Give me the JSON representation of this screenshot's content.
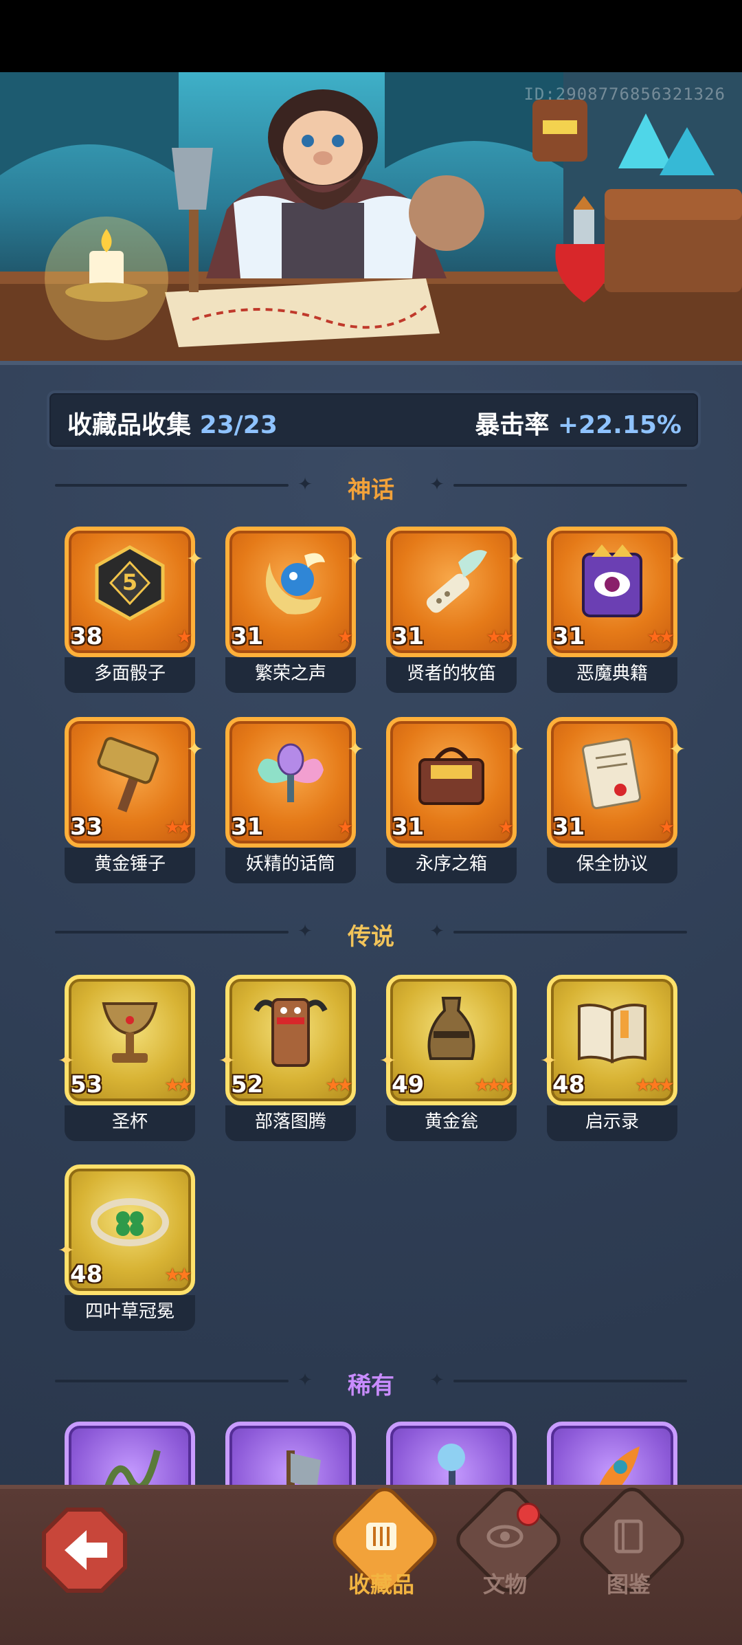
{
  "header": {
    "player_id": "ID:2908776856321326"
  },
  "collection": {
    "title": "收藏品收集",
    "count": "23/23",
    "bonus_label": "暴击率",
    "bonus_value": "+22.15%"
  },
  "sections": [
    {
      "title": "神话",
      "color": "#f2a23a"
    },
    {
      "title": "传说",
      "color": "#f2c45a"
    },
    {
      "title": "稀有",
      "color": "#c98cff"
    }
  ],
  "mythic": [
    {
      "name": "多面骰子",
      "level": "38",
      "stars": "★"
    },
    {
      "name": "繁荣之声",
      "level": "31",
      "stars": "★"
    },
    {
      "name": "贤者的牧笛",
      "level": "31",
      "stars": "★★"
    },
    {
      "name": "恶魔典籍",
      "level": "31",
      "stars": "★★"
    },
    {
      "name": "黄金锤子",
      "level": "33",
      "stars": "★★"
    },
    {
      "name": "妖精的话筒",
      "level": "31",
      "stars": "★"
    },
    {
      "name": "永序之箱",
      "level": "31",
      "stars": "★"
    },
    {
      "name": "保全协议",
      "level": "31",
      "stars": "★"
    }
  ],
  "legendary": [
    {
      "name": "圣杯",
      "level": "53",
      "stars": "★★"
    },
    {
      "name": "部落图腾",
      "level": "52",
      "stars": "★★"
    },
    {
      "name": "黄金瓮",
      "level": "49",
      "stars": "★★★"
    },
    {
      "name": "启示录",
      "level": "48",
      "stars": "★★★"
    },
    {
      "name": "四叶草冠冕",
      "level": "48",
      "stars": "★★"
    }
  ],
  "nav": {
    "tabs": [
      {
        "label": "收藏品",
        "color": "#f2b441"
      },
      {
        "label": "文物",
        "color": "#9a7b72"
      },
      {
        "label": "图鉴",
        "color": "#9a7b72"
      }
    ]
  }
}
